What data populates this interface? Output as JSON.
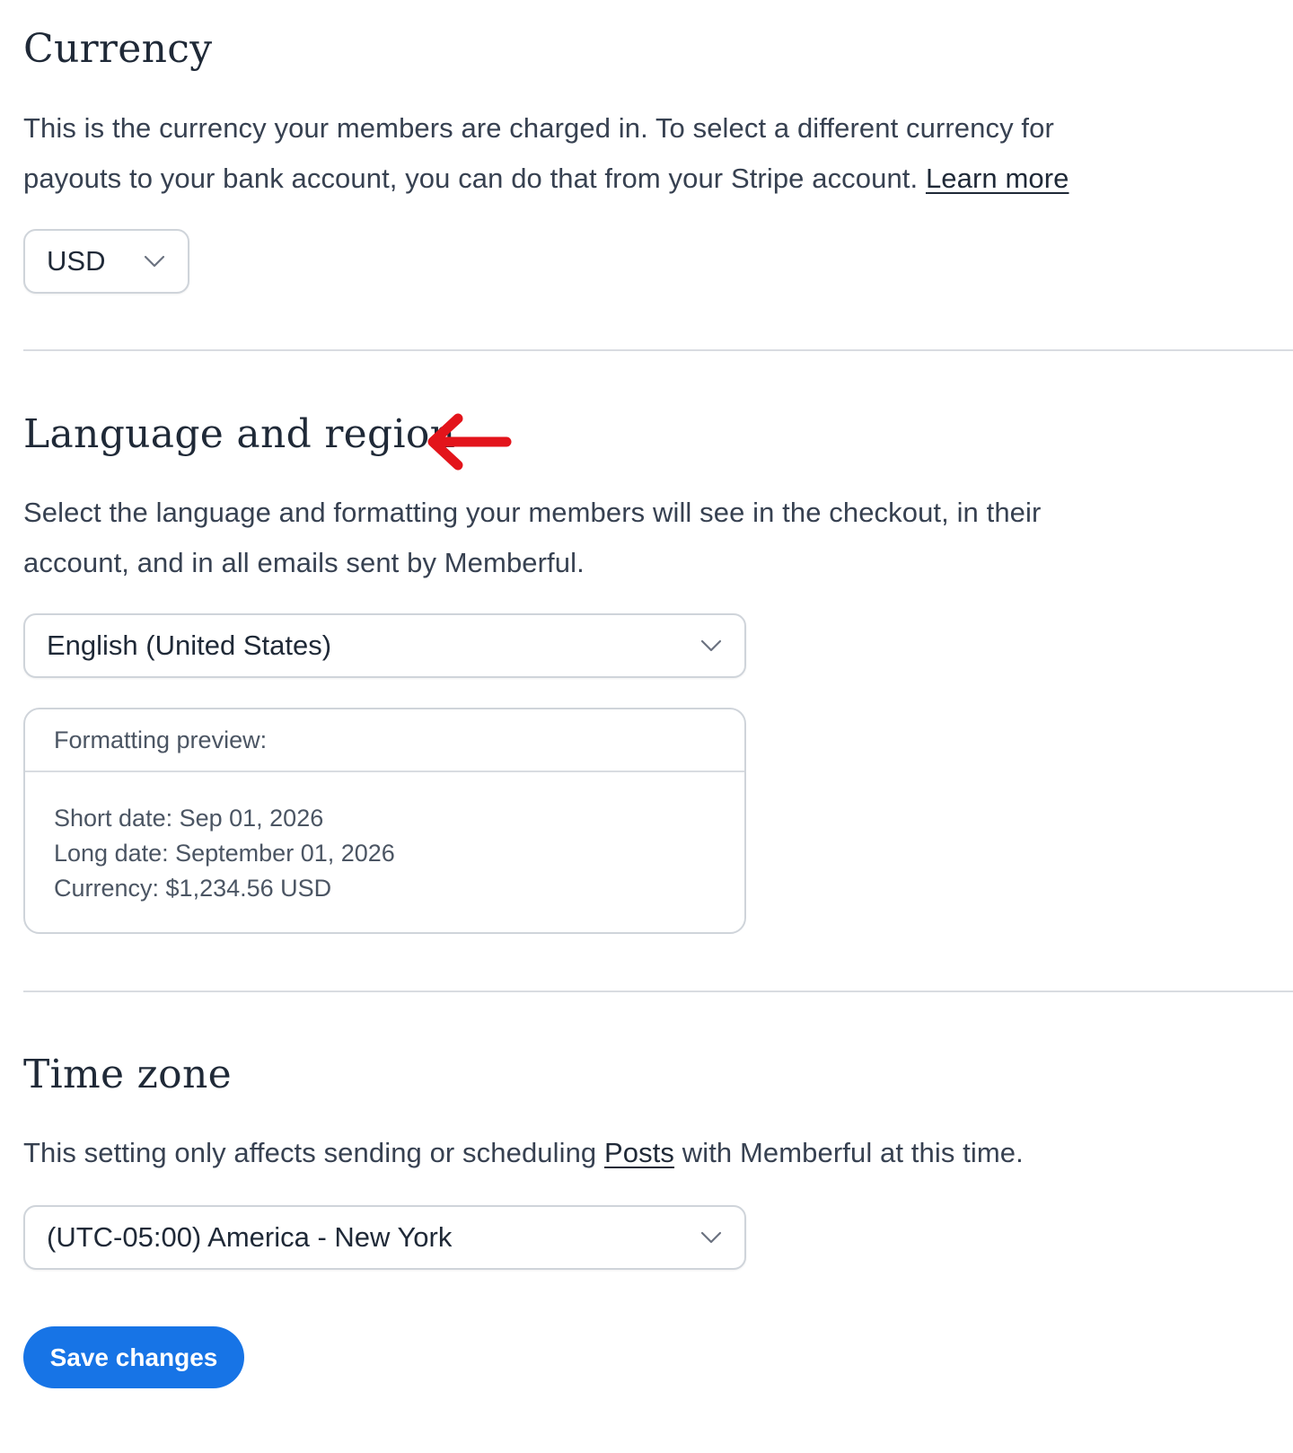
{
  "currency": {
    "heading": "Currency",
    "description": "This is the currency your members are charged in. To select a different currency for payouts to your bank account, you can do that from your Stripe account.",
    "learn_more": "Learn more",
    "selected": "USD"
  },
  "language": {
    "heading": "Language and region",
    "description": "Select the language and formatting your members will see in the checkout, in their account, and in all emails sent by Memberful.",
    "selected": "English (United States)",
    "preview": {
      "title": "Formatting preview:",
      "short_date": "Short date: Sep 01, 2026",
      "long_date": "Long date: September 01, 2026",
      "currency": "Currency: $1,234.56 USD"
    }
  },
  "timezone": {
    "heading": "Time zone",
    "description_before": "This setting only affects sending or scheduling",
    "posts_link": "Posts",
    "description_after": "with Memberful at this time.",
    "selected": "(UTC-05:00) America - New York"
  },
  "actions": {
    "save_label": "Save changes"
  },
  "colors": {
    "primary_button": "#1774e6",
    "annotation_arrow": "#e3141b"
  },
  "icons": {
    "select_chevron": "chevron-down-icon",
    "annotation": "arrow-left-icon"
  }
}
